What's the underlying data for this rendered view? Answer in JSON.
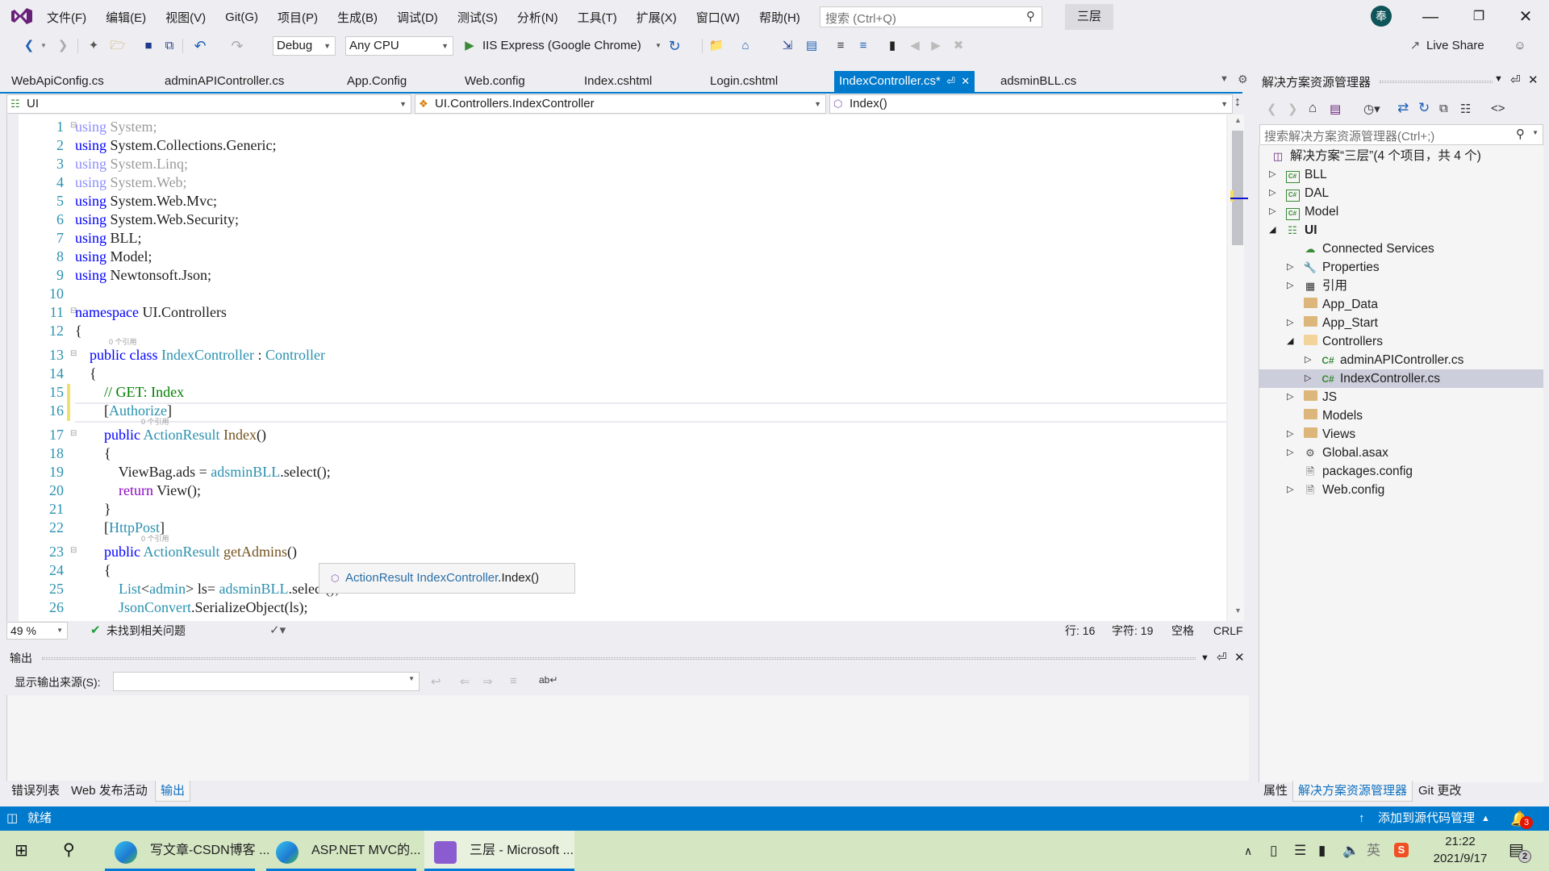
{
  "menubar": {
    "items": [
      "文件(F)",
      "编辑(E)",
      "视图(V)",
      "Git(G)",
      "项目(P)",
      "生成(B)",
      "调试(D)",
      "测试(S)",
      "分析(N)",
      "工具(T)",
      "扩展(X)",
      "窗口(W)",
      "帮助(H)"
    ],
    "search_placeholder": "搜索 (Ctrl+Q)",
    "solution_name": "三层",
    "avatar_initial": "奉",
    "minimize": "—",
    "restore": "❐",
    "close": "✕"
  },
  "toolbar": {
    "configuration": "Debug",
    "platform": "Any CPU",
    "run_target": "IIS Express (Google Chrome)",
    "live_share": "Live Share"
  },
  "doc_tabs": [
    {
      "label": "WebApiConfig.cs",
      "active": false
    },
    {
      "label": "adminAPIController.cs",
      "active": false
    },
    {
      "label": "App.Config",
      "active": false
    },
    {
      "label": "Web.config",
      "active": false
    },
    {
      "label": "Index.cshtml",
      "active": false
    },
    {
      "label": "Login.cshtml",
      "active": false
    },
    {
      "label": "IndexController.cs*",
      "active": true
    },
    {
      "label": "adsminBLL.cs",
      "active": false
    }
  ],
  "navbar": {
    "project": "UI",
    "type": "UI.Controllers.IndexController",
    "member": "Index()"
  },
  "editor": {
    "codelens": "0 个引用",
    "tooltip": {
      "type": "ActionResult",
      "member": "IndexController",
      "method": ".Index()"
    },
    "lines": [
      {
        "n": "1",
        "tokens": [
          [
            "kw dim",
            "using"
          ],
          [
            "dim",
            " System;"
          ]
        ]
      },
      {
        "n": "2",
        "tokens": [
          [
            "kw",
            "using"
          ],
          [
            "",
            " System.Collections.Generic;"
          ]
        ]
      },
      {
        "n": "3",
        "tokens": [
          [
            "kw dim",
            "using"
          ],
          [
            "dim",
            " System.Linq;"
          ]
        ]
      },
      {
        "n": "4",
        "tokens": [
          [
            "kw dim",
            "using"
          ],
          [
            "dim",
            " System.Web;"
          ]
        ]
      },
      {
        "n": "5",
        "tokens": [
          [
            "kw",
            "using"
          ],
          [
            "",
            " System.Web.Mvc;"
          ]
        ]
      },
      {
        "n": "6",
        "tokens": [
          [
            "kw",
            "using"
          ],
          [
            "",
            " System.Web.Security;"
          ]
        ]
      },
      {
        "n": "7",
        "tokens": [
          [
            "kw",
            "using"
          ],
          [
            "",
            " BLL;"
          ]
        ]
      },
      {
        "n": "8",
        "tokens": [
          [
            "kw",
            "using"
          ],
          [
            "",
            " Model;"
          ]
        ]
      },
      {
        "n": "9",
        "tokens": [
          [
            "kw",
            "using"
          ],
          [
            "",
            " Newtonsoft.Json;"
          ]
        ]
      },
      {
        "n": "10",
        "tokens": []
      },
      {
        "n": "11",
        "tokens": [
          [
            "kw",
            "namespace"
          ],
          [
            "",
            " UI.Controllers"
          ]
        ]
      },
      {
        "n": "12",
        "tokens": [
          [
            "",
            "{"
          ]
        ]
      },
      {
        "n": "13",
        "tokens": [
          [
            "",
            "    "
          ],
          [
            "kw",
            "public"
          ],
          [
            "",
            " "
          ],
          [
            "kw",
            "class"
          ],
          [
            "",
            " "
          ],
          [
            "ty",
            "IndexController"
          ],
          [
            "",
            " : "
          ],
          [
            "ty",
            "Controller"
          ]
        ]
      },
      {
        "n": "14",
        "tokens": [
          [
            "",
            "    {"
          ]
        ]
      },
      {
        "n": "15",
        "tokens": [
          [
            "",
            "        "
          ],
          [
            "cm",
            "// GET: Index"
          ]
        ]
      },
      {
        "n": "16",
        "tokens": [
          [
            "",
            "        ["
          ],
          [
            "ty",
            "Authorize"
          ],
          [
            "",
            "]"
          ]
        ]
      },
      {
        "n": "17",
        "tokens": [
          [
            "",
            "        "
          ],
          [
            "kw",
            "public"
          ],
          [
            "",
            " "
          ],
          [
            "ty",
            "ActionResult"
          ],
          [
            "",
            " "
          ],
          [
            "fn",
            "Index"
          ],
          [
            "",
            "()"
          ]
        ]
      },
      {
        "n": "18",
        "tokens": [
          [
            "",
            "        {"
          ]
        ]
      },
      {
        "n": "19",
        "tokens": [
          [
            "",
            "            ViewBag.ads = "
          ],
          [
            "ty",
            "adsminBLL"
          ],
          [
            "",
            ".select();"
          ]
        ]
      },
      {
        "n": "20",
        "tokens": [
          [
            "",
            "            "
          ],
          [
            "ctrl",
            "return"
          ],
          [
            "",
            " View();"
          ]
        ]
      },
      {
        "n": "21",
        "tokens": [
          [
            "",
            "        }"
          ]
        ]
      },
      {
        "n": "22",
        "tokens": [
          [
            "",
            "        ["
          ],
          [
            "ty",
            "HttpPost"
          ],
          [
            "",
            "]"
          ]
        ]
      },
      {
        "n": "23",
        "tokens": [
          [
            "",
            "        "
          ],
          [
            "kw",
            "public"
          ],
          [
            "",
            " "
          ],
          [
            "ty",
            "ActionResult"
          ],
          [
            "",
            " "
          ],
          [
            "fn",
            "getAdmins"
          ],
          [
            "",
            "()"
          ]
        ]
      },
      {
        "n": "24",
        "tokens": [
          [
            "",
            "        {"
          ]
        ]
      },
      {
        "n": "25",
        "tokens": [
          [
            "",
            "            "
          ],
          [
            "ty",
            "List"
          ],
          [
            "",
            "<"
          ],
          [
            "ty",
            "admin"
          ],
          [
            "",
            "> ls= "
          ],
          [
            "ty",
            "adsminBLL"
          ],
          [
            "",
            ".select();"
          ]
        ]
      },
      {
        "n": "26",
        "tokens": [
          [
            "",
            "            "
          ],
          [
            "ty",
            "JsonConvert"
          ],
          [
            "",
            ".SerializeObject(ls);"
          ]
        ]
      }
    ]
  },
  "editor_status": {
    "zoom": "49 %",
    "issues": "未找到相关问题",
    "line": "行: 16",
    "char": "字符: 19",
    "whitespace": "空格",
    "eol": "CRLF"
  },
  "output": {
    "title": "输出",
    "source_label": "显示输出来源(S):",
    "source_value": ""
  },
  "bottom_tabs": [
    {
      "label": "错误列表",
      "active": false
    },
    {
      "label": "Web 发布活动",
      "active": false
    },
    {
      "label": "输出",
      "active": true
    }
  ],
  "solution_explorer": {
    "title": "解决方案资源管理器",
    "search_placeholder": "搜索解决方案资源管理器(Ctrl+;)",
    "tree": [
      {
        "label": "解决方案“三层”(4 个项目，共 4 个)",
        "depth": 0,
        "icon": "solution",
        "expander": ""
      },
      {
        "label": "BLL",
        "depth": 1,
        "icon": "csproj",
        "expander": "collapsed"
      },
      {
        "label": "DAL",
        "depth": 1,
        "icon": "csproj",
        "expander": "collapsed"
      },
      {
        "label": "Model",
        "depth": 1,
        "icon": "csproj",
        "expander": "collapsed"
      },
      {
        "label": "UI",
        "depth": 1,
        "icon": "webproj",
        "expander": "expanded",
        "bold": true
      },
      {
        "label": "Connected Services",
        "depth": 2,
        "icon": "cloud",
        "expander": ""
      },
      {
        "label": "Properties",
        "depth": 2,
        "icon": "wrench",
        "expander": "collapsed"
      },
      {
        "label": "引用",
        "depth": 2,
        "icon": "references",
        "expander": "collapsed"
      },
      {
        "label": "App_Data",
        "depth": 2,
        "icon": "folder",
        "expander": ""
      },
      {
        "label": "App_Start",
        "depth": 2,
        "icon": "folder",
        "expander": "collapsed"
      },
      {
        "label": "Controllers",
        "depth": 2,
        "icon": "folder-open",
        "expander": "expanded"
      },
      {
        "label": "adminAPIController.cs",
        "depth": 3,
        "icon": "csfile",
        "expander": "collapsed"
      },
      {
        "label": "IndexController.cs",
        "depth": 3,
        "icon": "csfile",
        "expander": "collapsed",
        "selected": true
      },
      {
        "label": "JS",
        "depth": 2,
        "icon": "folder",
        "expander": "collapsed"
      },
      {
        "label": "Models",
        "depth": 2,
        "icon": "folder",
        "expander": ""
      },
      {
        "label": "Views",
        "depth": 2,
        "icon": "folder",
        "expander": "collapsed"
      },
      {
        "label": "Global.asax",
        "depth": 2,
        "icon": "asax",
        "expander": "collapsed"
      },
      {
        "label": "packages.config",
        "depth": 2,
        "icon": "config",
        "expander": ""
      },
      {
        "label": "Web.config",
        "depth": 2,
        "icon": "config",
        "expander": "collapsed"
      }
    ],
    "bottom_tabs": [
      {
        "label": "属性",
        "active": false
      },
      {
        "label": "解决方案资源管理器",
        "active": true
      },
      {
        "label": "Git 更改",
        "active": false
      }
    ]
  },
  "statusbar": {
    "ready": "就绪",
    "source_control": "添加到源代码管理",
    "notifications": "3"
  },
  "taskbar": {
    "apps": [
      {
        "label": "写文章-CSDN博客 ...",
        "icon": "edge"
      },
      {
        "label": "ASP.NET MVC的...",
        "icon": "edge"
      },
      {
        "label": "三层 - Microsoft ...",
        "icon": "visual-studio",
        "active": true
      }
    ],
    "ime": "英",
    "time": "21:22",
    "date": "2021/9/17",
    "action_center_count": "2"
  },
  "colors": {
    "accent": "#007acc",
    "selection": "#cccedb",
    "taskbar": "#d5e6c3"
  }
}
